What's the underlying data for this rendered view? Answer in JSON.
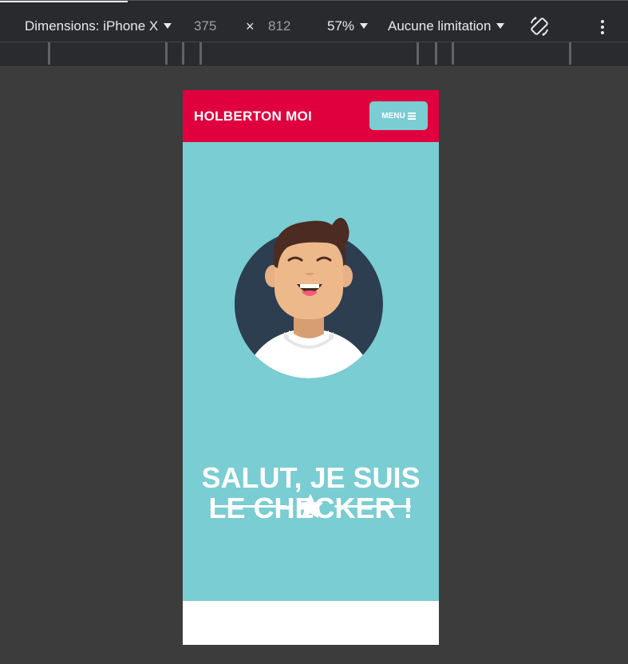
{
  "devtools": {
    "device_label": "Dimensions: iPhone X",
    "width": "375",
    "times": "×",
    "height": "812",
    "zoom": "57%",
    "throttling": "Aucune limitation",
    "icons": [
      "rotate-icon",
      "more-options-icon",
      "dropdown-caret-icon"
    ]
  },
  "site": {
    "brand": "HOLBERTON MOI",
    "menu_label": "MENU",
    "menu_icon": "hamburger-icon",
    "headline_line1": "SALUT, JE SUIS",
    "headline_line2": "LE CHECKER !",
    "divider_icon": "star-icon"
  },
  "colors": {
    "navbar": "#e0003d",
    "hero": "#7acdd2",
    "menu_button": "#7acdd2",
    "avatar_circle": "#2c3e50",
    "text": "#ffffff"
  }
}
